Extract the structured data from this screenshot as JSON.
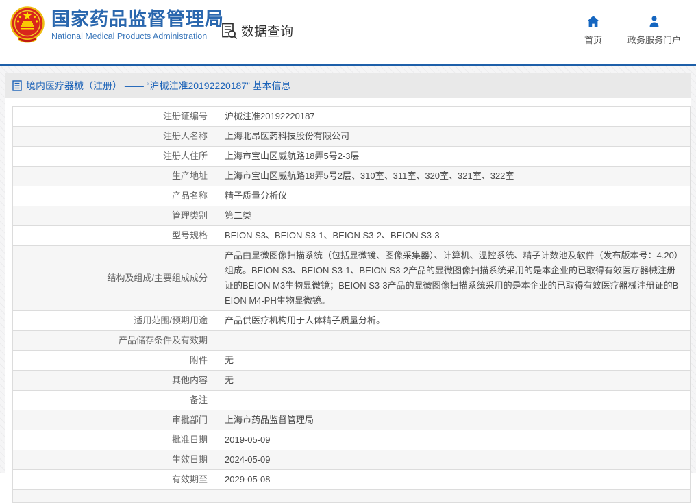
{
  "header": {
    "org_name_cn": "国家药品监督管理局",
    "org_name_en": "National Medical Products Administration",
    "section_label": "数据查询",
    "nav": [
      {
        "label": "首页",
        "icon": "home-icon"
      },
      {
        "label": "政务服务门户",
        "icon": "user-icon"
      }
    ]
  },
  "page": {
    "title": "境内医疗器械（注册） —— “沪械注准20192220187” 基本信息"
  },
  "table": {
    "rows": [
      {
        "label": "注册证编号",
        "value": "沪械注准20192220187"
      },
      {
        "label": "注册人名称",
        "value": "上海北昂医药科技股份有限公司"
      },
      {
        "label": "注册人住所",
        "value": "上海市宝山区威航路18弄5号2-3层"
      },
      {
        "label": "生产地址",
        "value": "上海市宝山区威航路18弄5号2层、310室、311室、320室、321室、322室"
      },
      {
        "label": "产品名称",
        "value": "精子质量分析仪"
      },
      {
        "label": "管理类别",
        "value": "第二类"
      },
      {
        "label": "型号规格",
        "value": "BEION S3、BEION S3-1、BEION S3-2、BEION S3-3"
      },
      {
        "label": "结构及组成/主要组成成分",
        "value": "产品由显微图像扫描系统（包括显微镜、图像采集器）、计算机、温控系统、精子计数池及软件（发布版本号：4.20）组成。BEION S3、BEION S3-1、BEION S3-2产品的显微图像扫描系统采用的是本企业的已取得有效医疗器械注册证的BEION M3生物显微镜；BEION S3-3产品的显微图像扫描系统采用的是本企业的已取得有效医疗器械注册证的BEION M4-PH生物显微镜。",
        "multiline": true
      },
      {
        "label": "适用范围/预期用途",
        "value": "产品供医疗机构用于人体精子质量分析。"
      },
      {
        "label": "产品储存条件及有效期",
        "value": ""
      },
      {
        "label": "附件",
        "value": "无"
      },
      {
        "label": "其他内容",
        "value": "无"
      },
      {
        "label": "备注",
        "value": ""
      },
      {
        "label": "审批部门",
        "value": "上海市药品监督管理局"
      },
      {
        "label": "批准日期",
        "value": "2019-05-09"
      },
      {
        "label": "生效日期",
        "value": "2024-05-09"
      },
      {
        "label": "有效期至",
        "value": "2029-05-08"
      },
      {
        "label": "",
        "value": "",
        "partial": true
      }
    ]
  },
  "colors": {
    "brand_blue": "#2a67ae",
    "link_blue": "#1b62b8",
    "divider_blue": "#1d5fa9",
    "title_bar_bg": "#e9e9e9",
    "zebra_row_bg": "#f6f6f6",
    "emblem_red": "#d8261c",
    "emblem_gold": "#ffde00"
  }
}
